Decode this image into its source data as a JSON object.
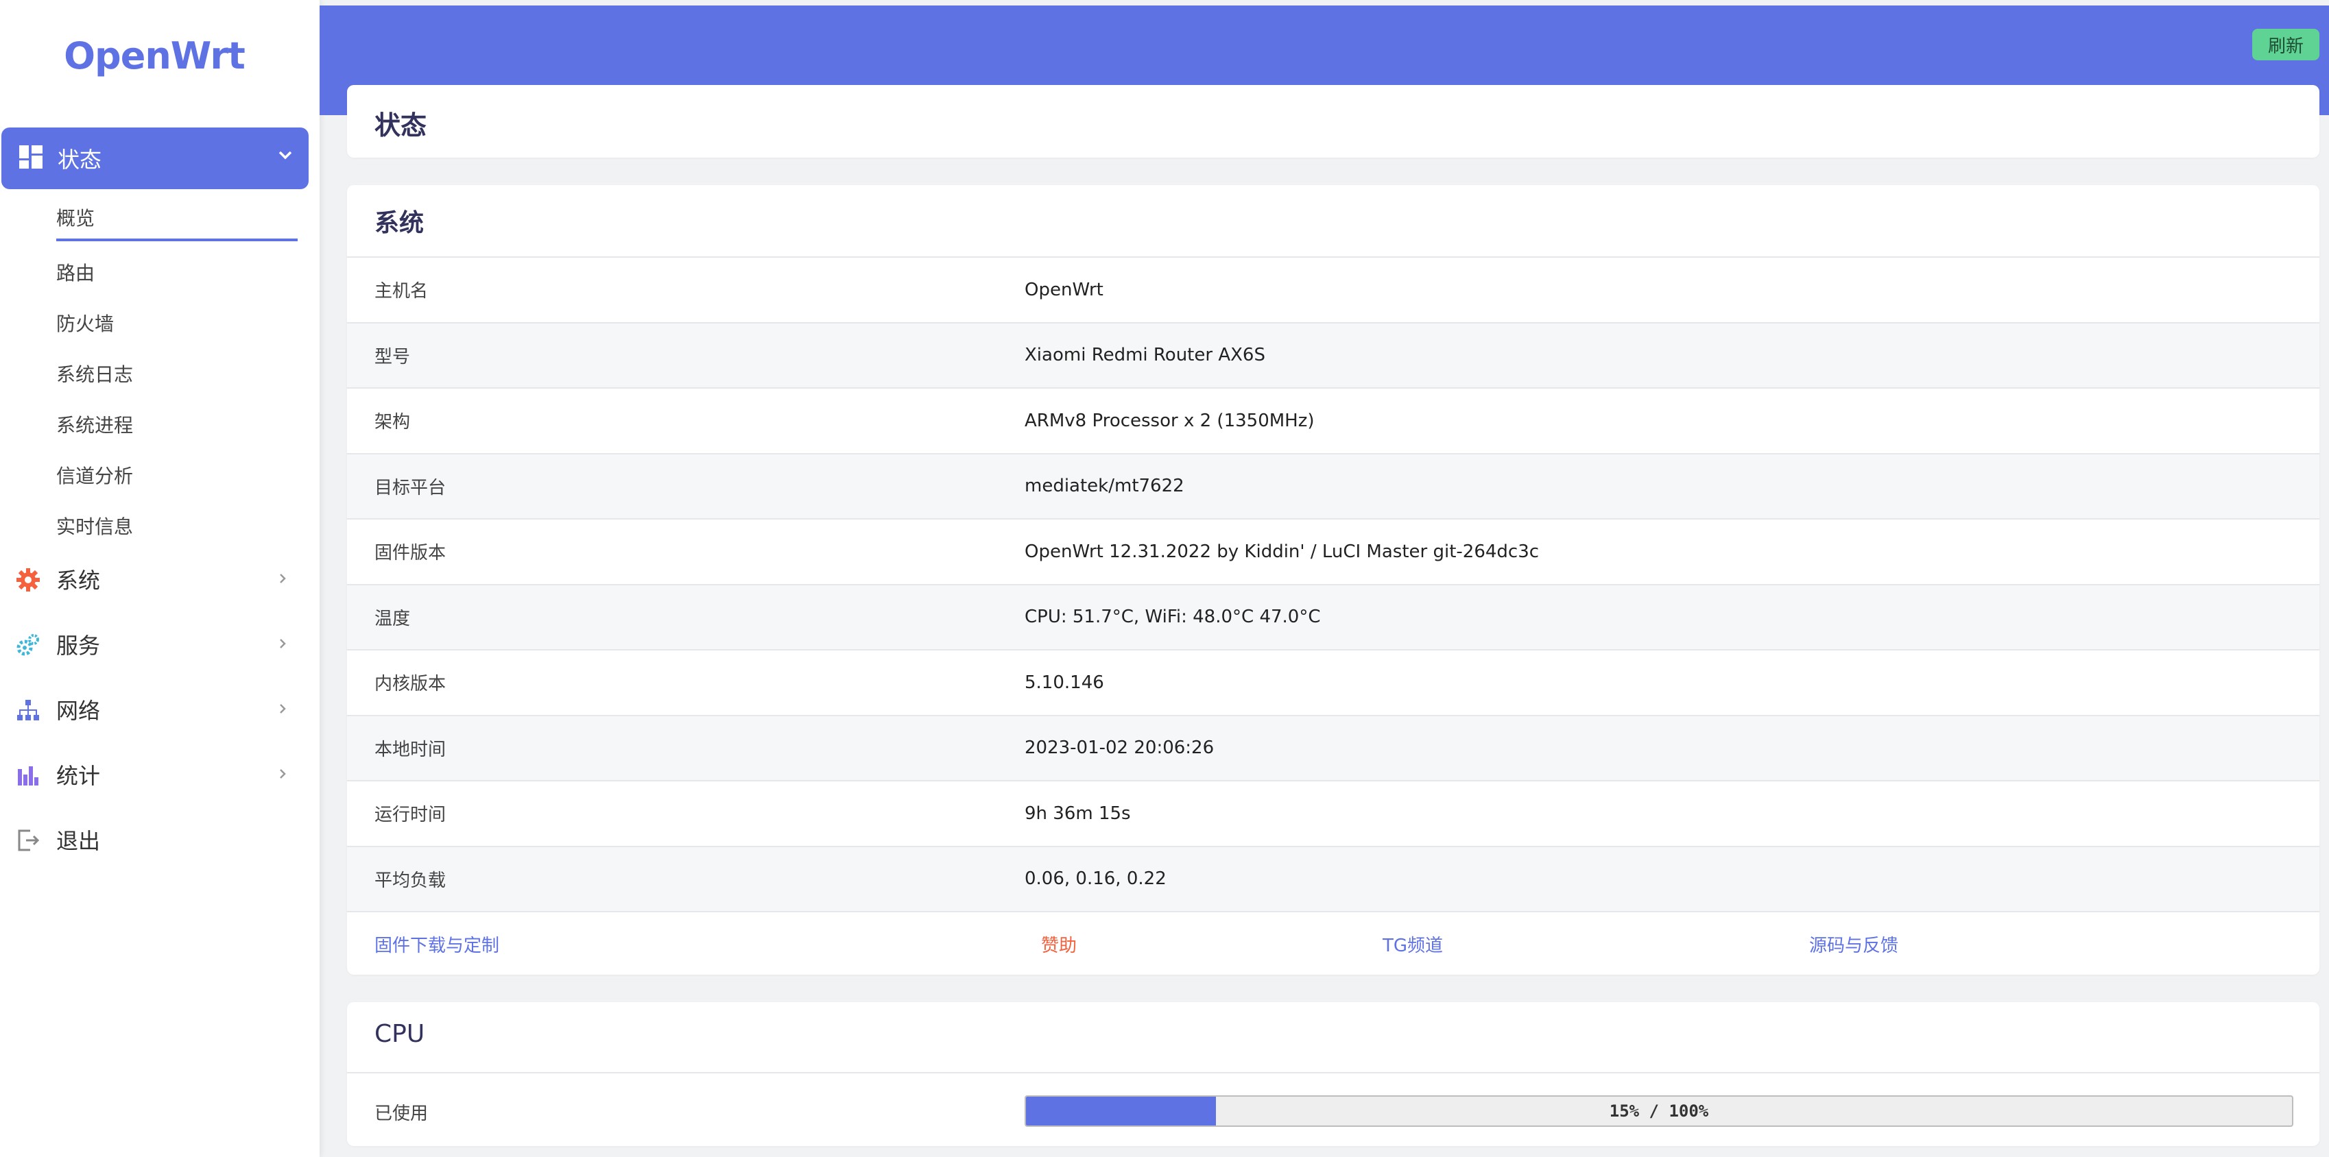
{
  "brand": {
    "logo": "OpenWrt"
  },
  "sidebar": {
    "active_section": {
      "label": "状态",
      "icon": "dashboard-icon"
    },
    "submenu": [
      {
        "label": "概览",
        "active": true
      },
      {
        "label": "路由"
      },
      {
        "label": "防火墙"
      },
      {
        "label": "系统日志"
      },
      {
        "label": "系统进程"
      },
      {
        "label": "信道分析"
      },
      {
        "label": "实时信息"
      }
    ],
    "items": [
      {
        "label": "系统",
        "icon": "gear-icon",
        "color": "#f5603d"
      },
      {
        "label": "服务",
        "icon": "gears-icon",
        "color": "#3fb7d9"
      },
      {
        "label": "网络",
        "icon": "sitemap-icon",
        "color": "#5e72e4"
      },
      {
        "label": "统计",
        "icon": "bar-chart-icon",
        "color": "#8a6de9"
      },
      {
        "label": "退出",
        "icon": "logout-icon",
        "color": "#888888"
      }
    ]
  },
  "header": {
    "refresh_label": "刷新"
  },
  "page": {
    "title": "状态"
  },
  "system": {
    "title": "系统",
    "rows": [
      {
        "key": "主机名",
        "value": "OpenWrt"
      },
      {
        "key": "型号",
        "value": "Xiaomi Redmi Router AX6S"
      },
      {
        "key": "架构",
        "value": "ARMv8 Processor x 2 (1350MHz)"
      },
      {
        "key": "目标平台",
        "value": "mediatek/mt7622"
      },
      {
        "key": "固件版本",
        "value": "OpenWrt 12.31.2022 by Kiddin' / LuCI Master git-264dc3c"
      },
      {
        "key": "温度",
        "value": "CPU: 51.7°C, WiFi: 48.0°C 47.0°C"
      },
      {
        "key": "内核版本",
        "value": "5.10.146"
      },
      {
        "key": "本地时间",
        "value": "2023-01-02 20:06:26"
      },
      {
        "key": "运行时间",
        "value": "9h 36m 15s"
      },
      {
        "key": "平均负载",
        "value": "0.06, 0.16, 0.22"
      }
    ],
    "links": [
      {
        "label": "固件下载与定制",
        "color": "#5e72e4"
      },
      {
        "label": "赞助",
        "color": "#f5603d"
      },
      {
        "label": "TG频道",
        "color": "#5e72e4"
      },
      {
        "label": "源码与反馈",
        "color": "#5e72e4"
      }
    ]
  },
  "cpu": {
    "title": "CPU",
    "used_label": "已使用",
    "progress_text": "15% / 100%",
    "progress_fraction": 0.15
  },
  "colors": {
    "accent": "#5e72e4",
    "refresh_button": "#5fd394"
  }
}
